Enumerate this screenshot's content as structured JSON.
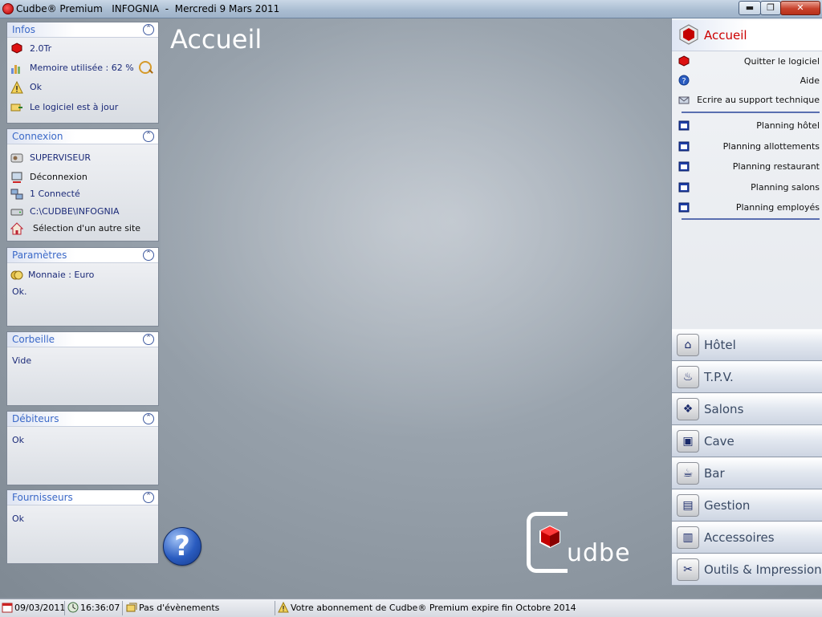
{
  "window": {
    "title": "Cudbe® Premium   INFOGNIA  -  Mercredi 9 Mars 2011",
    "min_label": "▬",
    "max_label": "❐",
    "close_label": "✕"
  },
  "main": {
    "page_title": "Accueil",
    "help_label": "?",
    "logo_text": "udbe"
  },
  "panels": {
    "infos": {
      "title": "Infos",
      "version": "2.0Tr",
      "memory": "Memoire utilisée : 62 %",
      "status": "Ok",
      "update": "Le logiciel est à jour"
    },
    "connexion": {
      "title": "Connexion",
      "user": "SUPERVISEUR",
      "logout": "Déconnexion",
      "connected": "1 Connecté",
      "path": "C:\\CUDBE\\INFOGNIA",
      "select_site": "Sélection d'un autre site"
    },
    "parametres": {
      "title": "Paramètres",
      "currency": "Monnaie : Euro",
      "status": "Ok."
    },
    "corbeille": {
      "title": "Corbeille",
      "status": "Vide"
    },
    "debiteurs": {
      "title": "Débiteurs",
      "status": "Ok"
    },
    "fournisseurs": {
      "title": "Fournisseurs",
      "status": "Ok"
    },
    "collapse_glyph": "⌃"
  },
  "right": {
    "header": "Accueil",
    "actions": [
      "Quitter le logiciel",
      "Aide",
      "Ecrire au support technique"
    ],
    "plannings": [
      "Planning hôtel",
      "Planning allottements",
      "Planning restaurant",
      "Planning salons",
      "Planning employés"
    ],
    "categories": [
      {
        "label": "Hôtel",
        "icon": "hotel-icon",
        "glyph": "⌂"
      },
      {
        "label": "T.P.V.",
        "icon": "tpv-icon",
        "glyph": "♨"
      },
      {
        "label": "Salons",
        "icon": "salons-icon",
        "glyph": "❖"
      },
      {
        "label": "Cave",
        "icon": "cave-icon",
        "glyph": "▣"
      },
      {
        "label": "Bar",
        "icon": "bar-icon",
        "glyph": "☕"
      },
      {
        "label": "Gestion",
        "icon": "gestion-icon",
        "glyph": "▤"
      },
      {
        "label": "Accessoires",
        "icon": "accessoires-icon",
        "glyph": "▥"
      },
      {
        "label": "Outils & Impressions",
        "icon": "outils-icon",
        "glyph": "✂"
      }
    ]
  },
  "statusbar": {
    "date": "09/03/2011",
    "time": "16:36:07",
    "events": "Pas d'évènements",
    "subscription": "Votre abonnement  de Cudbe® Premium expire fin Octobre 2014"
  },
  "colors": {
    "accent_blue": "#3b69c8",
    "text_navy": "#1b2a78",
    "accueil_red": "#cc0000"
  }
}
